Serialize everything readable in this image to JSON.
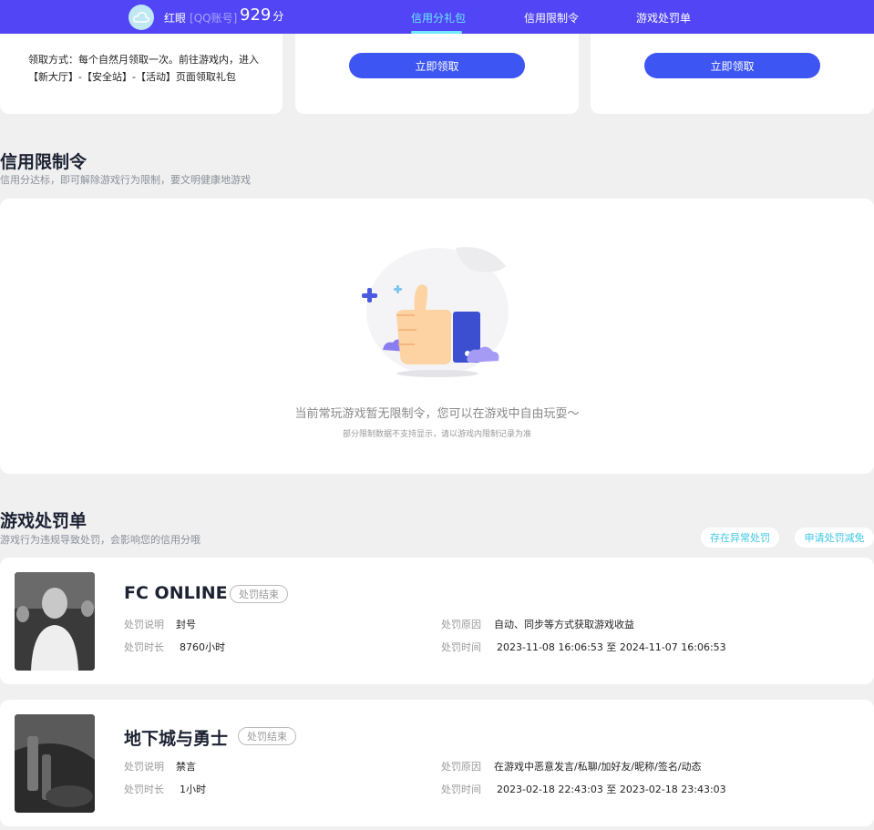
{
  "header": {
    "user_name": "红眼",
    "account_type": "[QQ账号]",
    "score": "929",
    "score_unit": "分",
    "tabs": [
      {
        "label": "信用分礼包",
        "active": true
      },
      {
        "label": "信用限制令",
        "active": false
      },
      {
        "label": "游戏处罚单",
        "active": false
      }
    ]
  },
  "gift": {
    "description": "领取方式：每个自然月领取一次。前往游戏内，进入【新大厅】-【安全站】-【活动】页面领取礼包",
    "claim_label_1": "立即领取",
    "claim_label_2": "立即领取"
  },
  "restriction": {
    "title": "信用限制令",
    "subtitle": "信用分达标，即可解除游戏行为限制，要文明健康地游戏",
    "empty_text": "当前常玩游戏暂无限制令，您可以在游戏中自由玩耍～",
    "empty_sub": "部分限制数据不支持显示，请以游戏内限制记录为准"
  },
  "penalty": {
    "title": "游戏处罚单",
    "subtitle": "游戏行为违规导致处罚，会影响您的信用分哦",
    "abnormal_label": "存在异常处罚",
    "reduce_label": "申请处罚减免",
    "items": [
      {
        "game": "FC ONLINE",
        "status": "处罚结束",
        "desc_label": "处罚说明",
        "desc": "封号",
        "duration_label": "处罚时长",
        "duration": "8760小时",
        "reason_label": "处罚原因",
        "reason": "自动、同步等方式获取游戏收益",
        "time_label": "处罚时间",
        "time": "2023-11-08 16:06:53 至 2024-11-07 16:06:53"
      },
      {
        "game": "地下城与勇士",
        "status": "处罚结束",
        "desc_label": "处罚说明",
        "desc": "禁言",
        "duration_label": "处罚时长",
        "duration": "1小时",
        "reason_label": "处罚原因",
        "reason": "在游戏中恶意发言/私聊/加好友/昵称/签名/动态",
        "time_label": "处罚时间",
        "time": "2023-02-18 22:43:03 至 2023-02-18 23:43:03"
      }
    ]
  },
  "colors": {
    "header_bg": "#5145f5",
    "active_tab": "#6ee7ff",
    "button_blue": "#3d55f2",
    "page_bg": "#f0f0f0"
  }
}
